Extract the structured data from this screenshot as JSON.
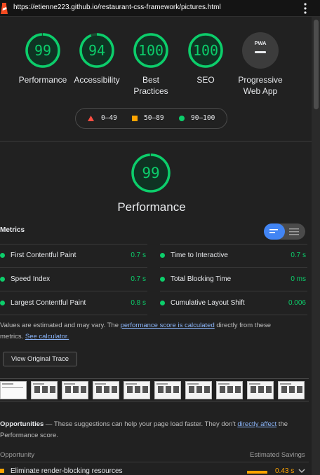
{
  "browser": {
    "url": "https://etienne223.github.io/restaurant-css-framework/pictures.html"
  },
  "gauges": [
    {
      "score": "99",
      "label": "Performance",
      "value": 0.99
    },
    {
      "score": "94",
      "label": "Accessibility",
      "value": 0.94
    },
    {
      "score": "100",
      "label": "Best Practices",
      "value": 1.0
    },
    {
      "score": "100",
      "label": "SEO",
      "value": 1.0
    }
  ],
  "pwa": {
    "badge": "PWA",
    "label": "Progressive Web App"
  },
  "legend": {
    "fail": "0–49",
    "average": "50–89",
    "pass": "90–100"
  },
  "performance": {
    "score": "99",
    "value": 0.99,
    "title": "Performance"
  },
  "metrics": {
    "title": "Metrics",
    "items": [
      {
        "name": "First Contentful Paint",
        "value": "0.7 s"
      },
      {
        "name": "Time to Interactive",
        "value": "0.7 s"
      },
      {
        "name": "Speed Index",
        "value": "0.7 s"
      },
      {
        "name": "Total Blocking Time",
        "value": "0 ms"
      },
      {
        "name": "Largest Contentful Paint",
        "value": "0.8 s"
      },
      {
        "name": "Cumulative Layout Shift",
        "value": "0.006"
      }
    ]
  },
  "note": {
    "prefix": "Values are estimated and may vary. The ",
    "link1": "performance score is calculated",
    "middle": " directly from these metrics. ",
    "link2": "See calculator."
  },
  "trace_button": "View Original Trace",
  "opportunities": {
    "title": "Opportunities",
    "dash": " — ",
    "desc_prefix": "These suggestions can help your page load faster. They don't ",
    "link": "directly affect",
    "desc_suffix": " the Performance score.",
    "col_opportunity": "Opportunity",
    "col_savings": "Estimated Savings",
    "row_name": "Eliminate render-blocking resources",
    "row_value": "0.43 s"
  },
  "colors": {
    "pass": "#0cce6b",
    "average": "#ffa400",
    "fail": "#ff4e42",
    "link": "#8ab4f8",
    "accent": "#4285f4"
  }
}
